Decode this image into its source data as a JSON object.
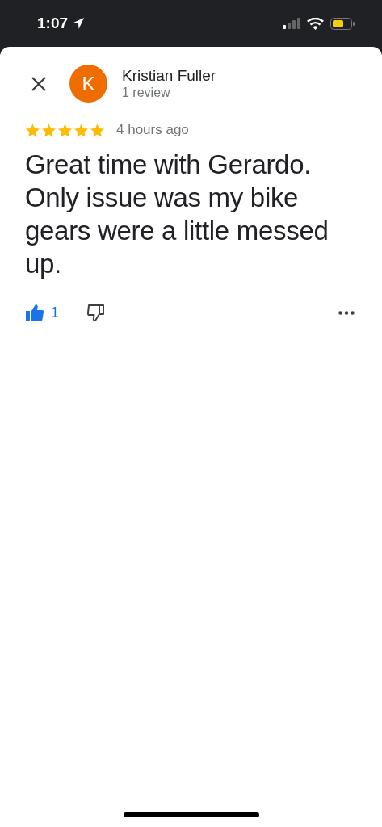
{
  "status_bar": {
    "time": "1:07"
  },
  "review": {
    "avatar_letter": "K",
    "author": "Kristian Fuller",
    "author_meta": "1 review",
    "stars": 5,
    "time": "4 hours ago",
    "text": "Great time with Gerardo. Only issue was my bike gears were a little messed up.",
    "like": {
      "count": "1",
      "selected": true
    },
    "dislike": {
      "selected": false
    }
  }
}
